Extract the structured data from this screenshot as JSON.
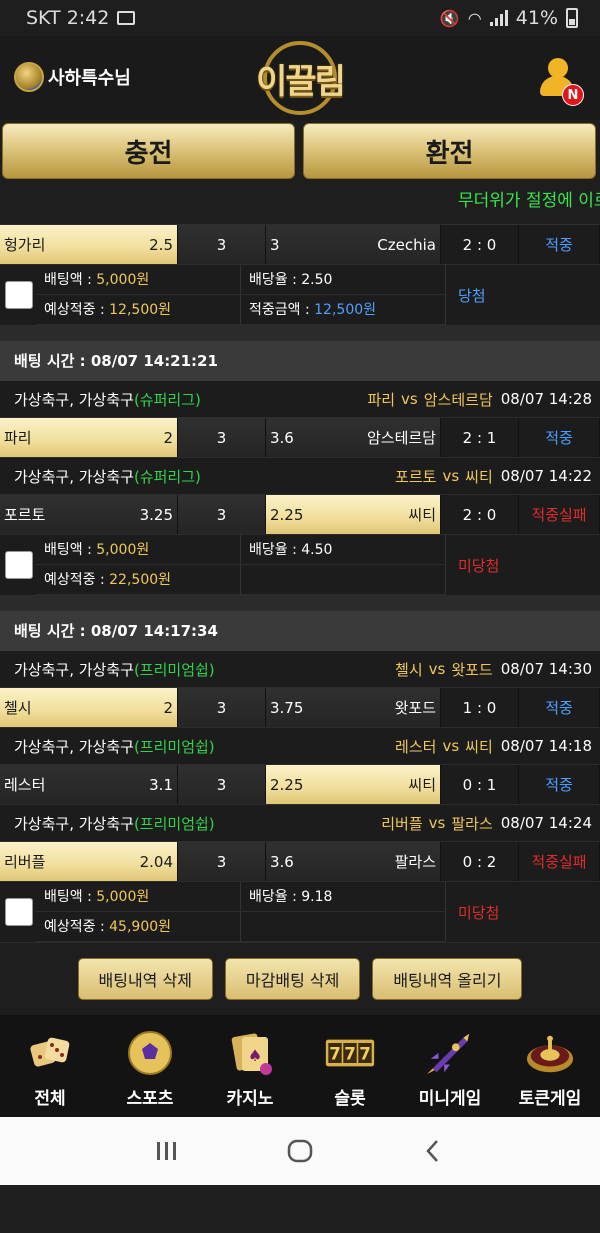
{
  "status": {
    "carrier_time": "SKT 2:42",
    "battery": "41%"
  },
  "header": {
    "username": "사하특수님",
    "logo_text": "이끌림",
    "notify_badge": "N"
  },
  "buttons": {
    "charge": "충전",
    "exchange": "환전"
  },
  "marquee": "무더위가 절정에 이르",
  "blocks": [
    {
      "matches": [
        {
          "home": "헝가리",
          "home_odds": "2.5",
          "draw": "3",
          "away_odds": "3",
          "away": "Czechia",
          "score": "2 : 0",
          "result": "적중",
          "selected": "home",
          "result_type": "ok"
        }
      ],
      "summary": {
        "bet_label": "배팅액 : ",
        "bet_amount": "5,000원",
        "exp_label": "예상적중 : ",
        "exp_amount": "12,500원",
        "rate_label": "배당율 : ",
        "rate": "2.50",
        "win_label": "적중금액 : ",
        "win_amount": "12,500원",
        "status": "당첨"
      }
    },
    {
      "bet_time": "배팅 시간 : 08/07 14:21:21",
      "matches": [
        {
          "league": "가상축구, 가상축구 ",
          "sub": "(슈퍼리그)",
          "t1": "파리",
          "vs": "vs",
          "t2": "암스테르담",
          "when": "08/07 14:28",
          "home": "파리",
          "home_odds": "2",
          "draw": "3",
          "away_odds": "3.6",
          "away": "암스테르담",
          "score": "2 : 1",
          "result": "적중",
          "selected": "home",
          "result_type": "ok"
        },
        {
          "league": "가상축구, 가상축구 ",
          "sub": "(슈퍼리그)",
          "t1": "포르토",
          "vs": "vs",
          "t2": "씨티",
          "when": "08/07 14:22",
          "home": "포르토",
          "home_odds": "3.25",
          "draw": "3",
          "away_odds": "2.25",
          "away": "씨티",
          "score": "2 : 0",
          "result": "적중실패",
          "selected": "away",
          "result_type": "fail"
        }
      ],
      "summary": {
        "bet_label": "배팅액 : ",
        "bet_amount": "5,000원",
        "exp_label": "예상적중 : ",
        "exp_amount": "22,500원",
        "rate_label": "배당율 : ",
        "rate": "4.50",
        "status": "미당첨"
      }
    },
    {
      "bet_time": "배팅 시간 : 08/07 14:17:34",
      "matches": [
        {
          "league": "가상축구, 가상축구 ",
          "sub": "(프리미엄쉽)",
          "t1": "첼시",
          "vs": "vs",
          "t2": "왓포드",
          "when": "08/07 14:30",
          "home": "첼시",
          "home_odds": "2",
          "draw": "3",
          "away_odds": "3.75",
          "away": "왓포드",
          "score": "1 : 0",
          "result": "적중",
          "selected": "home",
          "result_type": "ok"
        },
        {
          "league": "가상축구, 가상축구 ",
          "sub": "(프리미엄쉽)",
          "t1": "레스터",
          "vs": "vs",
          "t2": "씨티",
          "when": "08/07 14:18",
          "home": "레스터",
          "home_odds": "3.1",
          "draw": "3",
          "away_odds": "2.25",
          "away": "씨티",
          "score": "0 : 1",
          "result": "적중",
          "selected": "away",
          "result_type": "ok"
        },
        {
          "league": "가상축구, 가상축구 ",
          "sub": "(프리미엄쉽)",
          "t1": "리버플",
          "vs": "vs",
          "t2": "팔라스",
          "when": "08/07 14:24",
          "home": "리버플",
          "home_odds": "2.04",
          "draw": "3",
          "away_odds": "3.6",
          "away": "팔라스",
          "score": "0 : 2",
          "result": "적중실패",
          "selected": "home",
          "result_type": "fail"
        }
      ],
      "summary": {
        "bet_label": "배팅액 : ",
        "bet_amount": "5,000원",
        "exp_label": "예상적중 : ",
        "exp_amount": "45,900원",
        "rate_label": "배당율 : ",
        "rate": "9.18",
        "status": "미당첨"
      }
    }
  ],
  "actions": {
    "delete": "배팅내역 삭제",
    "delete_closed": "마감배팅 삭제",
    "upload": "배팅내역 올리기"
  },
  "nav": [
    {
      "label": "전체",
      "icon": "dice-icon"
    },
    {
      "label": "스포츠",
      "icon": "soccer-ball-icon"
    },
    {
      "label": "카지노",
      "icon": "cards-icon"
    },
    {
      "label": "슬롯",
      "icon": "slot-777-icon"
    },
    {
      "label": "미니게임",
      "icon": "rocket-icon"
    },
    {
      "label": "토큰게임",
      "icon": "roulette-icon"
    }
  ],
  "colors": {
    "gold": "#f0c85a",
    "hit": "#4da0ff",
    "miss": "#e02c2c",
    "league": "#31d34a",
    "marquee": "#38e64a"
  }
}
